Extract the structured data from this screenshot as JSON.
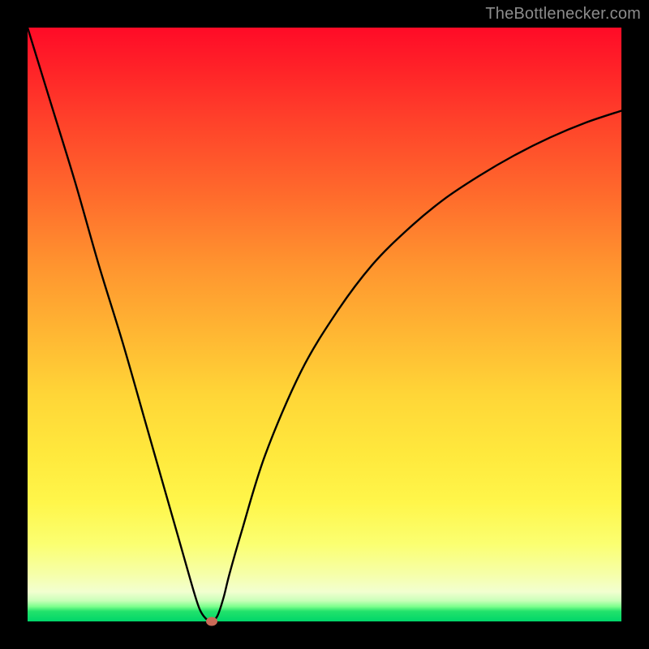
{
  "watermark": "TheBottlenecker.com",
  "colors": {
    "frame": "#000000",
    "gradient_top": "#ff0b27",
    "gradient_bottom": "#00d66a",
    "curve": "#000000",
    "marker": "#c96a57"
  },
  "chart_data": {
    "type": "line",
    "title": "",
    "xlabel": "",
    "ylabel": "",
    "xlim": [
      0,
      100
    ],
    "ylim": [
      0,
      100
    ],
    "series": [
      {
        "name": "curve",
        "x": [
          0,
          4,
          8,
          12,
          16,
          20,
          24,
          26,
          28,
          29,
          30,
          31,
          32,
          33,
          34,
          36,
          40,
          46,
          52,
          58,
          64,
          70,
          76,
          82,
          88,
          94,
          100
        ],
        "y": [
          100,
          87,
          74,
          60,
          47,
          33,
          19,
          12,
          5,
          2,
          0.5,
          0,
          1,
          4,
          8,
          15,
          28,
          42,
          52,
          60,
          66,
          71,
          75,
          78.5,
          81.5,
          84,
          86
        ]
      }
    ],
    "marker": {
      "x": 31,
      "y": 0
    },
    "grid": false,
    "legend": false,
    "notes": "Values are read off pixel positions; the y-axis is unlabeled so values are normalized 0–100 where 0 is the plot bottom and 100 is the plot top."
  }
}
